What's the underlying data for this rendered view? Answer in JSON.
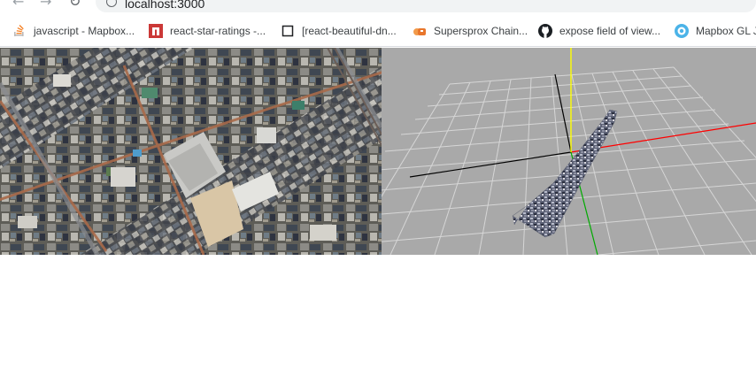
{
  "browser": {
    "url": "localhost:3000",
    "nav_icons": [
      "back-arrow-icon",
      "forward-arrow-icon",
      "reload-icon",
      "info-icon"
    ]
  },
  "bookmarks": [
    {
      "icon": "stackoverflow-icon",
      "label": "javascript - Mapbox..."
    },
    {
      "icon": "npm-icon",
      "label": "react-star-ratings -..."
    },
    {
      "icon": "document-icon",
      "label": "[react-beautiful-dn..."
    },
    {
      "icon": "supersprox-icon",
      "label": "Supersprox Chain..."
    },
    {
      "icon": "github-icon",
      "label": "expose field of view..."
    },
    {
      "icon": "mapbox-icon",
      "label": "Mapbox GL J"
    }
  ],
  "viewer_3d": {
    "axis_colors": {
      "x": "#ff0000",
      "y": "#ffff00",
      "z": "#00aa00",
      "negative": "#000000"
    },
    "grid_color": "#d9d9d9",
    "background": "#a9a9a9"
  },
  "map_view": {
    "content": "satellite aerial imagery"
  }
}
